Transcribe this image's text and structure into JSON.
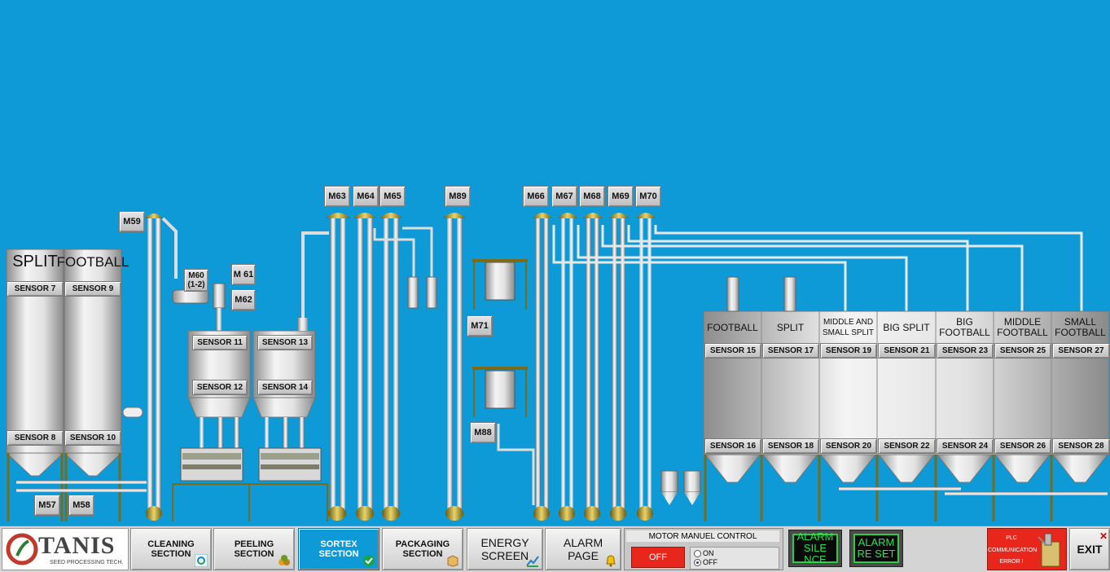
{
  "colors": {
    "background": "#0d9ad6",
    "active_tab": "#0d9ad6",
    "alarm_text": "#29e34a",
    "off_button": "#e8261c",
    "plc_error": "#e8261c"
  },
  "storage": {
    "split": "SPLIT",
    "football": "FOOTBALL",
    "sensor7": "SENSOR 7",
    "sensor8": "SENSOR 8",
    "sensor9": "SENSOR 9",
    "sensor10": "SENSOR 10"
  },
  "bins": {
    "sensor11": "SENSOR 11",
    "sensor12": "SENSOR 12",
    "sensor13": "SENSOR 13",
    "sensor14": "SENSOR 14"
  },
  "motors": {
    "m57": "M57",
    "m58": "M58",
    "m59": "M59",
    "m60": "M60",
    "m60_sub": "(1-2)",
    "m61": "M 61",
    "m62": "M62",
    "m63": "M63",
    "m64": "M64",
    "m65": "M65",
    "m89": "M89",
    "m71": "M71",
    "m88": "M88",
    "m66": "M66",
    "m67": "M67",
    "m68": "M68",
    "m69": "M69",
    "m70": "M70"
  },
  "silos": [
    {
      "title": "FOOTBALL",
      "top": "SENSOR 15",
      "bottom": "SENSOR 16"
    },
    {
      "title": "SPLIT",
      "top": "SENSOR 17",
      "bottom": "SENSOR 18"
    },
    {
      "title": "MIDDLE AND SMALL SPLIT",
      "top": "SENSOR 19",
      "bottom": "SENSOR 20"
    },
    {
      "title": "BIG SPLIT",
      "top": "SENSOR 21",
      "bottom": "SENSOR 22"
    },
    {
      "title": "BIG FOOTBALL",
      "top": "SENSOR 23",
      "bottom": "SENSOR 24"
    },
    {
      "title": "MIDDLE FOOTBALL",
      "top": "SENSOR 25",
      "bottom": "SENSOR 26"
    },
    {
      "title": "SMALL FOOTBALL",
      "top": "SENSOR 27",
      "bottom": "SENSOR 28"
    }
  ],
  "toolbar": {
    "logo": "TANIS",
    "logo_sub": "SEED PROCESSING TECH.",
    "cleaning": "CLEANING SECTION",
    "peeling": "PEELING SECTION",
    "sortex": "SORTEX SECTION",
    "packaging": "PACKAGING SECTION",
    "energy": "ENERGY SCREEN",
    "alarm_page": "ALARM PAGE",
    "motor_control_title": "MOTOR MANUEL CONTROL",
    "motor_state": "OFF",
    "radio_on": "ON",
    "radio_off": "OFF",
    "radio_selected": "OFF",
    "alarm_silence": "ALARM SILE NCE",
    "alarm_reset": "ALARM RE SET",
    "plc_line1": "PLC",
    "plc_line2": "COMMUNICATION",
    "plc_line3": "ERROR !",
    "exit": "EXIT"
  }
}
